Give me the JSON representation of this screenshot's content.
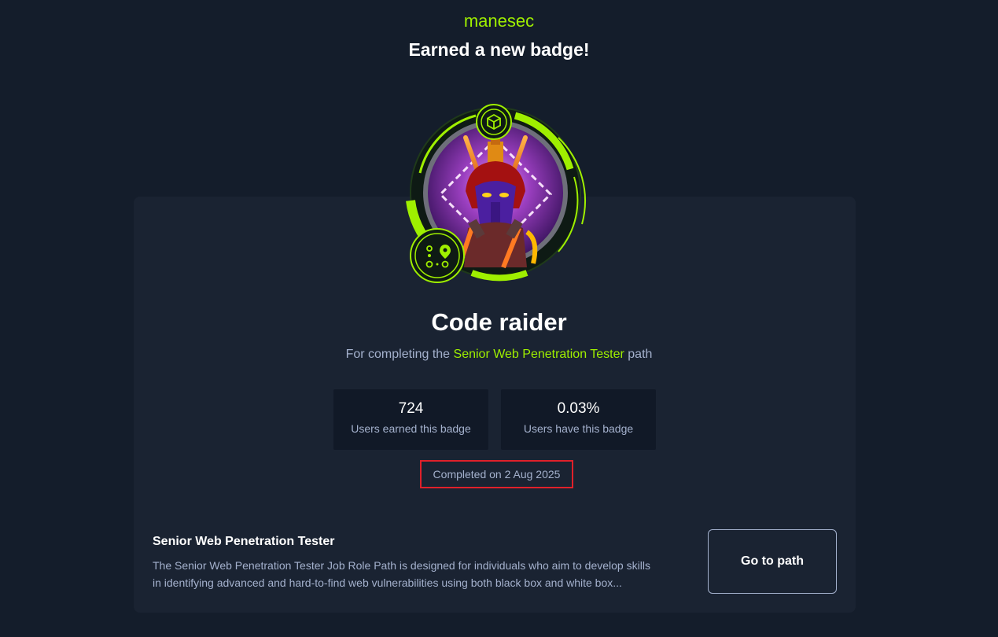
{
  "header": {
    "username": "manesec",
    "headline": "Earned a new badge!"
  },
  "badge": {
    "title": "Code raider",
    "description_prefix": "For completing the ",
    "description_path": "Senior Web Penetration Tester",
    "description_suffix": " path",
    "icons": [
      "cube-icon",
      "path-map-icon"
    ],
    "colors": {
      "accent": "#9fef00",
      "ring_inner": "#4a1d6e",
      "background": "#141d2b",
      "card": "#1a2332",
      "stat_box": "#111927",
      "highlight_border": "#e0202a"
    }
  },
  "stats": [
    {
      "value": "724",
      "label": "Users earned this badge"
    },
    {
      "value": "0.03%",
      "label": "Users have this badge"
    }
  ],
  "completed": "Completed on 2 Aug 2025",
  "path": {
    "name": "Senior Web Penetration Tester",
    "description": "The Senior Web Penetration Tester Job Role Path is designed for individuals who aim to develop skills in identifying advanced and hard-to-find web vulnerabilities using both black box and white box...",
    "button_label": "Go to path"
  }
}
